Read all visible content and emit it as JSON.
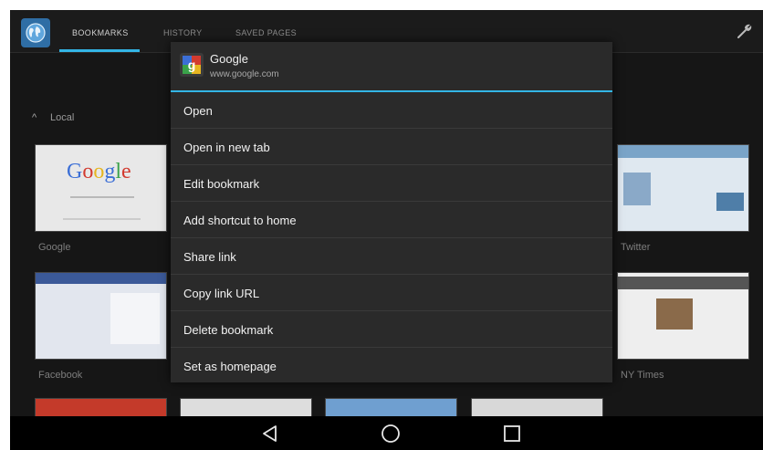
{
  "tabs": [
    {
      "label": "BOOKMARKS",
      "active": true
    },
    {
      "label": "HISTORY",
      "active": false
    },
    {
      "label": "SAVED PAGES",
      "active": false
    }
  ],
  "accent_color": "#33b5e5",
  "local_section": {
    "label": "Local"
  },
  "bookmarks": [
    {
      "caption": "Google",
      "google_word": "Google"
    },
    {
      "caption": "Twitter"
    },
    {
      "caption": "Facebook"
    },
    {
      "caption": "NY Times"
    }
  ],
  "context_menu": {
    "title": "Google",
    "url": "www.google.com",
    "items": [
      "Open",
      "Open in new tab",
      "Edit bookmark",
      "Add shortcut to home",
      "Share link",
      "Copy link URL",
      "Delete bookmark",
      "Set as homepage"
    ]
  },
  "icons": {
    "app": "globe-icon",
    "settings": "wrench-icon",
    "favicon": "google-favicon-icon",
    "nav": [
      "back-icon",
      "home-icon",
      "recents-icon"
    ]
  }
}
